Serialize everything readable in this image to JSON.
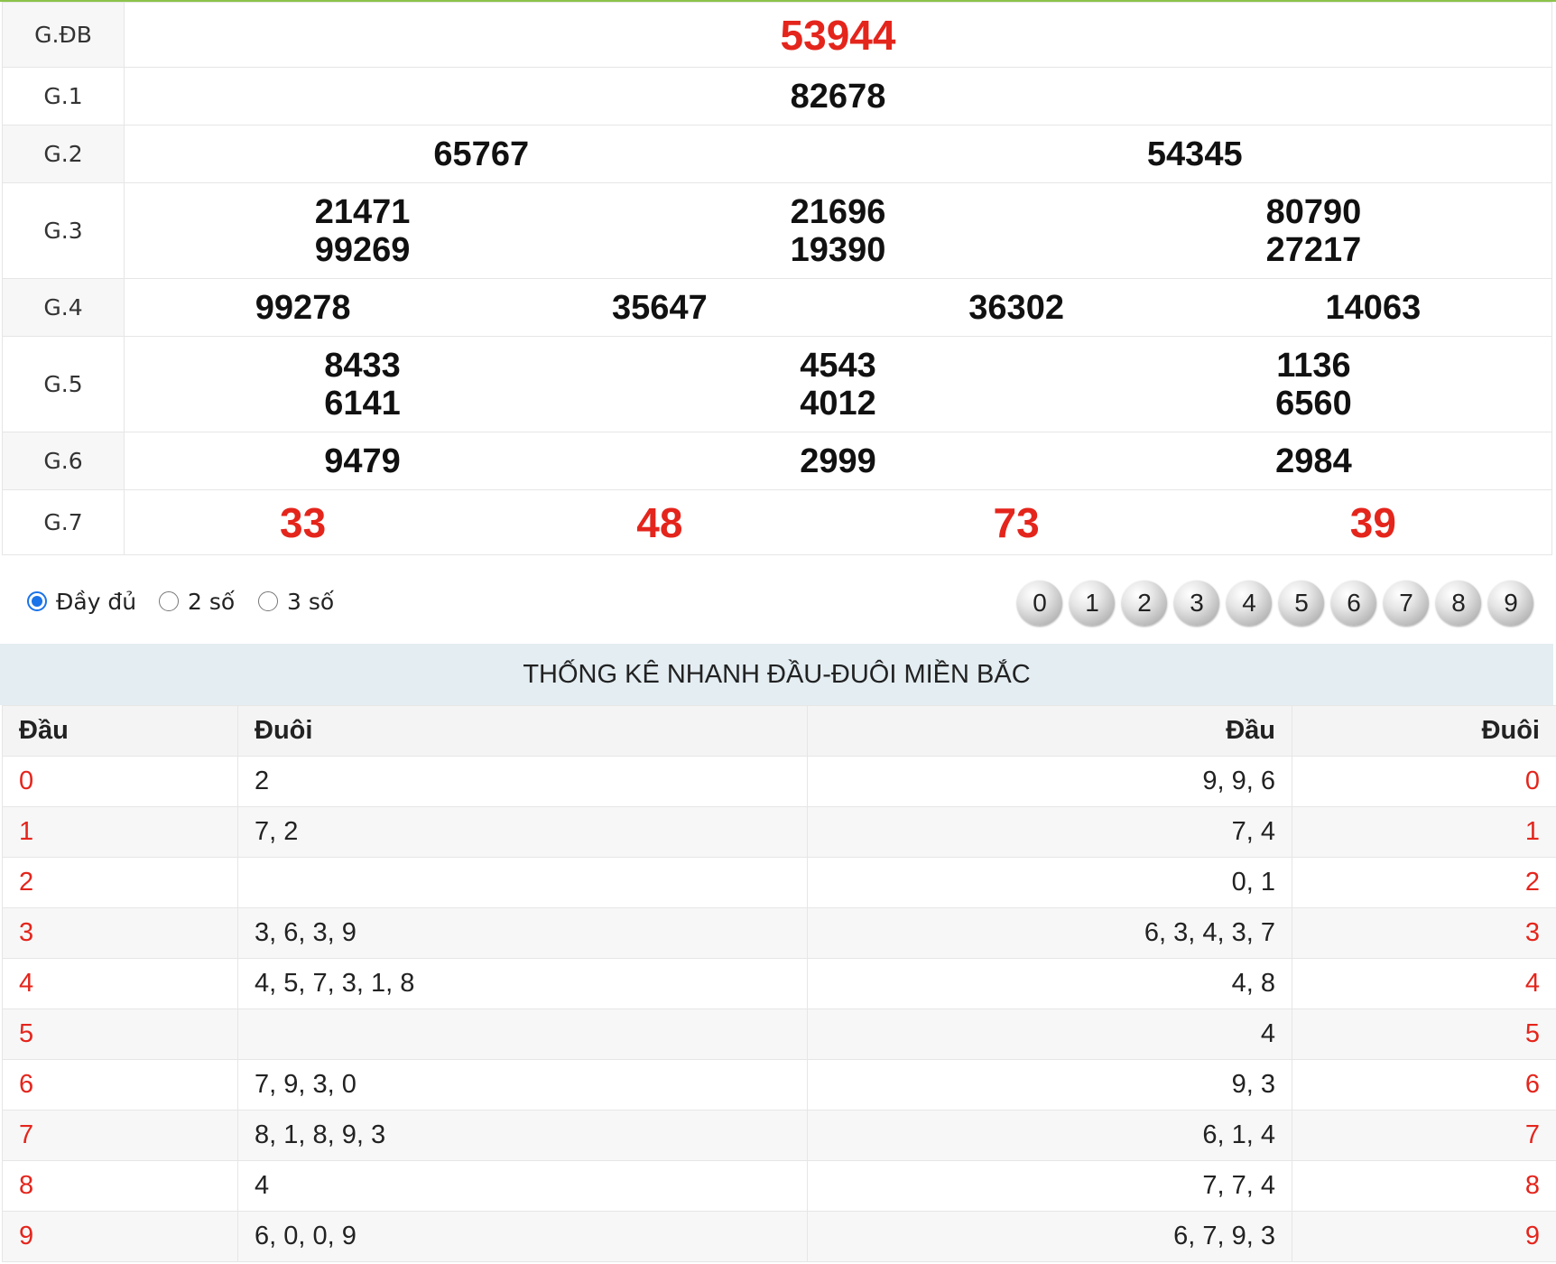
{
  "results": {
    "rows": [
      {
        "label": "G.ĐB",
        "numbers": [
          "53944"
        ]
      },
      {
        "label": "G.1",
        "numbers": [
          "82678"
        ]
      },
      {
        "label": "G.2",
        "numbers": [
          "65767",
          "54345"
        ]
      },
      {
        "label": "G.3",
        "numbers": [
          "21471",
          "21696",
          "80790",
          "99269",
          "19390",
          "27217"
        ]
      },
      {
        "label": "G.4",
        "numbers": [
          "99278",
          "35647",
          "36302",
          "14063"
        ]
      },
      {
        "label": "G.5",
        "numbers": [
          "8433",
          "4543",
          "1136",
          "6141",
          "4012",
          "6560"
        ]
      },
      {
        "label": "G.6",
        "numbers": [
          "9479",
          "2999",
          "2984"
        ]
      },
      {
        "label": "G.7",
        "numbers": [
          "33",
          "48",
          "73",
          "39"
        ]
      }
    ]
  },
  "filters": {
    "options": [
      "Đầy đủ",
      "2 số",
      "3 số"
    ],
    "selected": "Đầy đủ",
    "balls": [
      "0",
      "1",
      "2",
      "3",
      "4",
      "5",
      "6",
      "7",
      "8",
      "9"
    ]
  },
  "stats": {
    "title": "THỐNG KÊ NHANH ĐẦU-ĐUÔI MIỀN BẮC",
    "headers": [
      "Đầu",
      "Đuôi",
      "Đầu",
      "Đuôi"
    ],
    "rows": [
      {
        "dau": "0",
        "duoi": "2",
        "dau2": "9, 9, 6",
        "duoi2": "0"
      },
      {
        "dau": "1",
        "duoi": "7, 2",
        "dau2": "7, 4",
        "duoi2": "1"
      },
      {
        "dau": "2",
        "duoi": "",
        "dau2": "0, 1",
        "duoi2": "2"
      },
      {
        "dau": "3",
        "duoi": "3, 6, 3, 9",
        "dau2": "6, 3, 4, 3, 7",
        "duoi2": "3"
      },
      {
        "dau": "4",
        "duoi": "4, 5, 7, 3, 1, 8",
        "dau2": "4, 8",
        "duoi2": "4"
      },
      {
        "dau": "5",
        "duoi": "",
        "dau2": "4",
        "duoi2": "5"
      },
      {
        "dau": "6",
        "duoi": "7, 9, 3, 0",
        "dau2": "9, 3",
        "duoi2": "6"
      },
      {
        "dau": "7",
        "duoi": "8, 1, 8, 9, 3",
        "dau2": "6, 1, 4",
        "duoi2": "7"
      },
      {
        "dau": "8",
        "duoi": "4",
        "dau2": "7, 7, 4",
        "duoi2": "8"
      },
      {
        "dau": "9",
        "duoi": "6, 0, 0, 9",
        "dau2": "6, 7, 9, 3",
        "duoi2": "9"
      }
    ]
  },
  "colors": {
    "red": "#e4251c",
    "accent": "#8bc34a",
    "header_band": "#e3edf2",
    "radio": "#1a73e8"
  }
}
